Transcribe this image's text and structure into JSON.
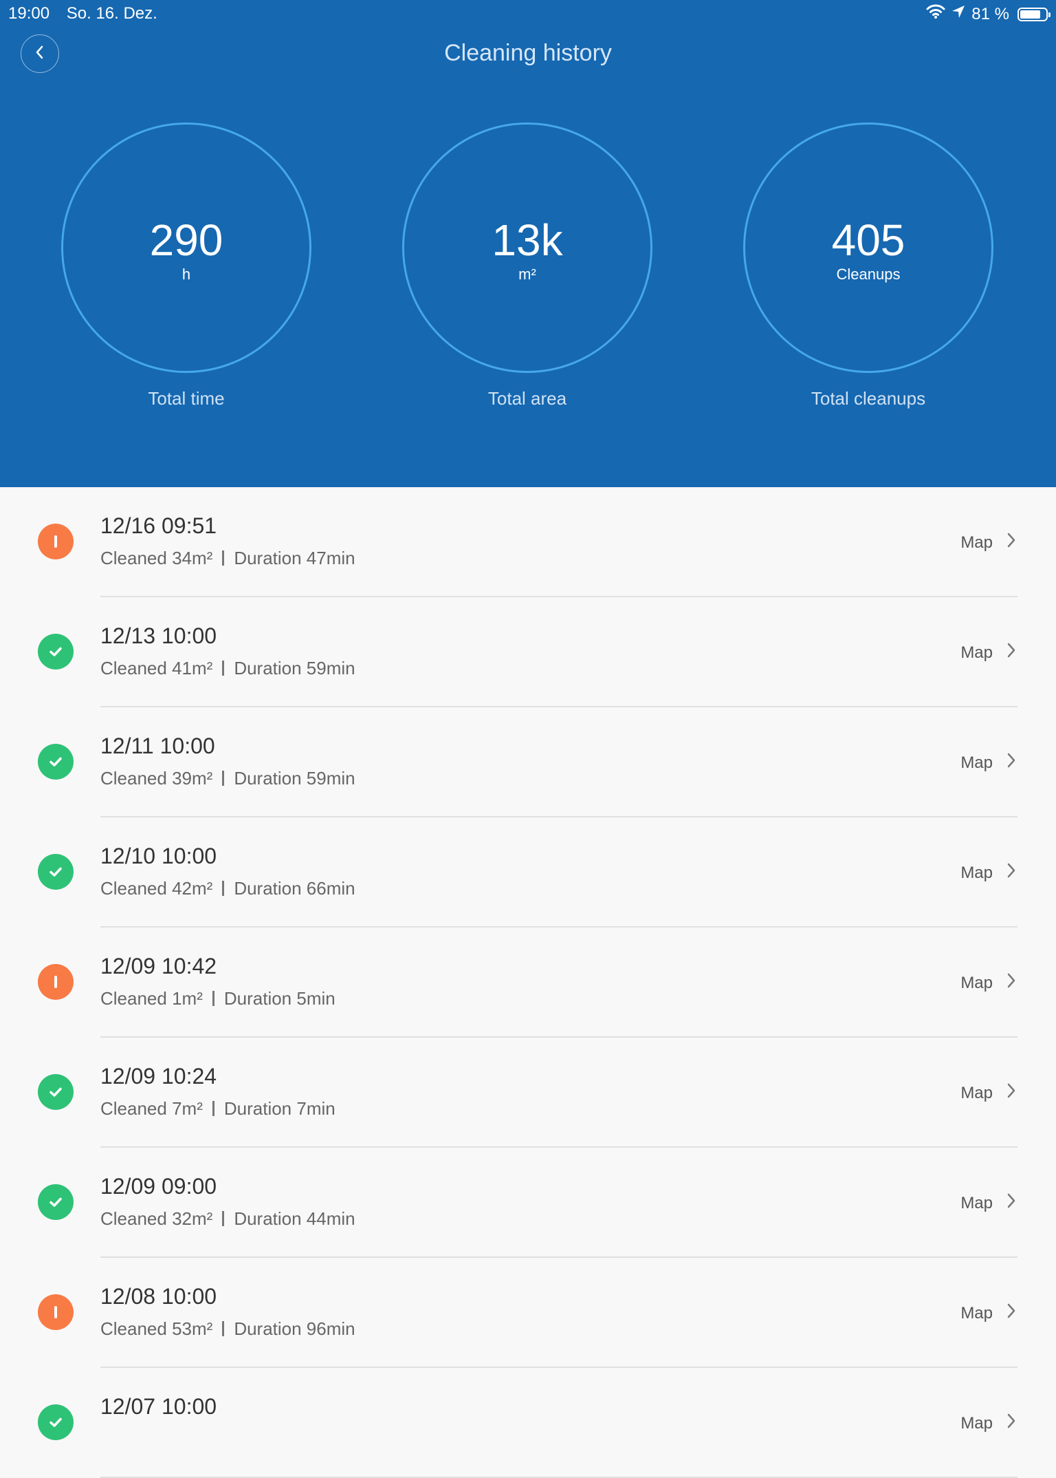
{
  "status_bar": {
    "time": "19:00",
    "date": "So. 16. Dez.",
    "battery": "81 %",
    "battery_level_percent": 81,
    "icons": [
      "wifi-icon",
      "location-arrow-icon",
      "battery-icon"
    ]
  },
  "header": {
    "title": "Cleaning history",
    "back_icon": "chevron-left-icon",
    "background_color": "#1668b1",
    "ring_color": "#45a7ec"
  },
  "stats": [
    {
      "value": "290",
      "unit": "h",
      "label": "Total time"
    },
    {
      "value": "13k",
      "unit": "m²",
      "label": "Total area"
    },
    {
      "value": "405",
      "unit": "Cleanups",
      "label": "Total cleanups"
    }
  ],
  "colors": {
    "success": "#2ec276",
    "warning": "#f87a45"
  },
  "history": [
    {
      "status": "warning",
      "icon": "exclamation-icon",
      "date": "12/16 09:51",
      "cleaned": "Cleaned 34m²",
      "duration": "Duration 47min",
      "map_label": "Map"
    },
    {
      "status": "success",
      "icon": "checkmark-icon",
      "date": "12/13 10:00",
      "cleaned": "Cleaned 41m²",
      "duration": "Duration 59min",
      "map_label": "Map"
    },
    {
      "status": "success",
      "icon": "checkmark-icon",
      "date": "12/11 10:00",
      "cleaned": "Cleaned 39m²",
      "duration": "Duration 59min",
      "map_label": "Map"
    },
    {
      "status": "success",
      "icon": "checkmark-icon",
      "date": "12/10 10:00",
      "cleaned": "Cleaned 42m²",
      "duration": "Duration 66min",
      "map_label": "Map"
    },
    {
      "status": "warning",
      "icon": "exclamation-icon",
      "date": "12/09 10:42",
      "cleaned": "Cleaned 1m²",
      "duration": "Duration 5min",
      "map_label": "Map"
    },
    {
      "status": "success",
      "icon": "checkmark-icon",
      "date": "12/09 10:24",
      "cleaned": "Cleaned 7m²",
      "duration": "Duration 7min",
      "map_label": "Map"
    },
    {
      "status": "success",
      "icon": "checkmark-icon",
      "date": "12/09 09:00",
      "cleaned": "Cleaned 32m²",
      "duration": "Duration 44min",
      "map_label": "Map"
    },
    {
      "status": "warning",
      "icon": "exclamation-icon",
      "date": "12/08 10:00",
      "cleaned": "Cleaned 53m²",
      "duration": "Duration 96min",
      "map_label": "Map"
    },
    {
      "status": "success",
      "icon": "checkmark-icon",
      "date": "12/07 10:00",
      "cleaned": "",
      "duration": "",
      "map_label": "Map"
    }
  ]
}
